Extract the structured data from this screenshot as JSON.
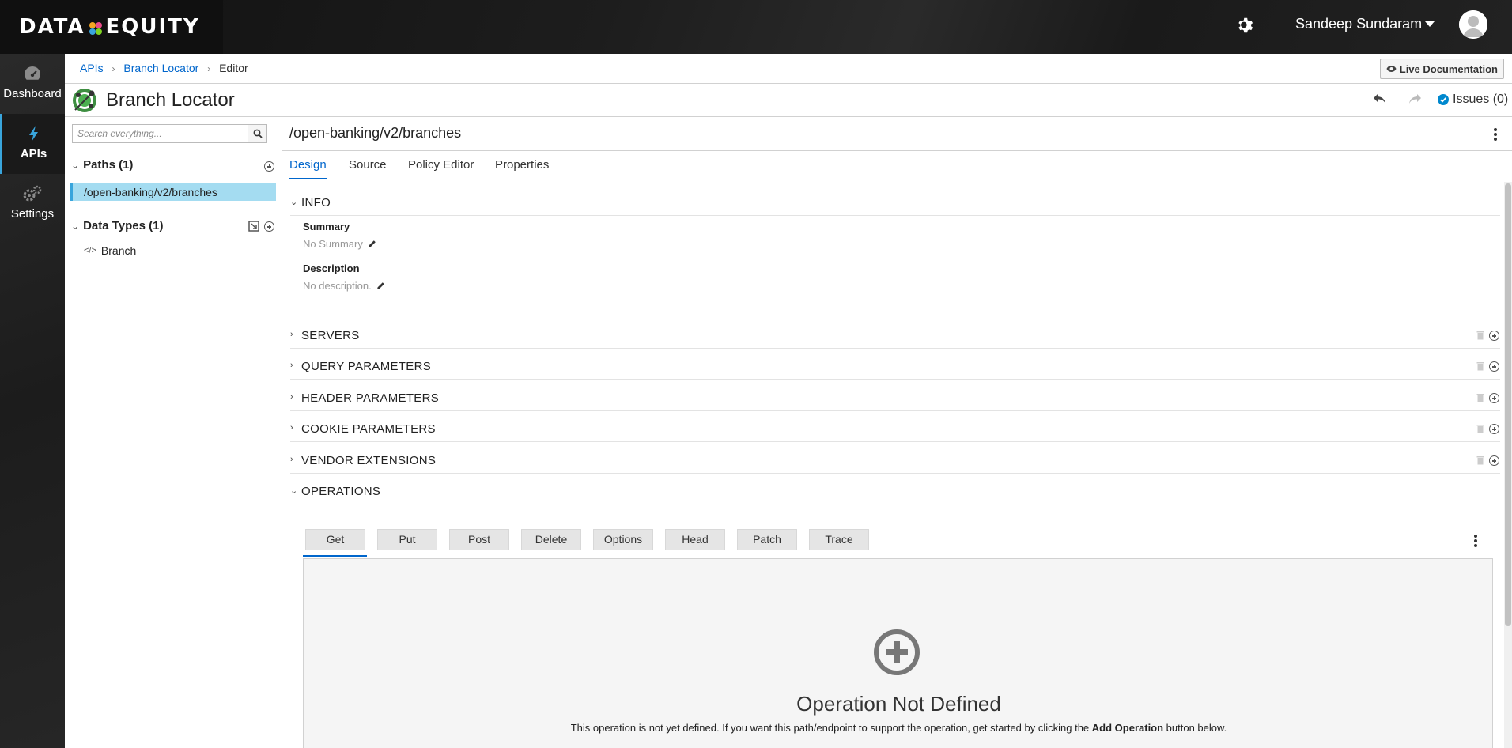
{
  "header": {
    "logo_left": "DATA",
    "logo_right": "EQUITY",
    "user_name": "Sandeep Sundaram"
  },
  "nav": {
    "items": [
      {
        "label": "Dashboard",
        "icon": "dashboard-icon"
      },
      {
        "label": "APIs",
        "icon": "bolt-icon"
      },
      {
        "label": "Settings",
        "icon": "gears-icon"
      }
    ]
  },
  "breadcrumb": {
    "items": [
      "APIs",
      "Branch Locator",
      "Editor"
    ],
    "live_doc_label": "Live Documentation"
  },
  "title": {
    "api_name": "Branch Locator",
    "issues_label": "Issues (0)"
  },
  "sidebar": {
    "search_placeholder": "Search everything...",
    "paths_header": "Paths (1)",
    "path_items": [
      "/open-banking/v2/branches"
    ],
    "datatypes_header": "Data Types (1)",
    "datatype_items": [
      "Branch"
    ]
  },
  "main": {
    "path_title": "/open-banking/v2/branches",
    "tabs": [
      "Design",
      "Source",
      "Policy Editor",
      "Properties"
    ],
    "info_section": "INFO",
    "summary_label": "Summary",
    "summary_value": "No Summary",
    "description_label": "Description",
    "description_value": "No description.",
    "sections": [
      "SERVERS",
      "QUERY PARAMETERS",
      "HEADER PARAMETERS",
      "COOKIE PARAMETERS",
      "VENDOR EXTENSIONS"
    ],
    "operations_section": "OPERATIONS",
    "operation_tabs": [
      "Get",
      "Put",
      "Post",
      "Delete",
      "Options",
      "Head",
      "Patch",
      "Trace"
    ],
    "not_defined_title": "Operation Not Defined",
    "not_defined_desc_1": "This operation is not yet defined. If you want this path/endpoint to support the operation, get started by clicking the ",
    "not_defined_desc_bold": "Add Operation",
    "not_defined_desc_2": " button below."
  },
  "colors": {
    "accent": "#0066cc",
    "selected_path_bg": "#a4dcf1",
    "nav_active": "#39a5dc"
  }
}
